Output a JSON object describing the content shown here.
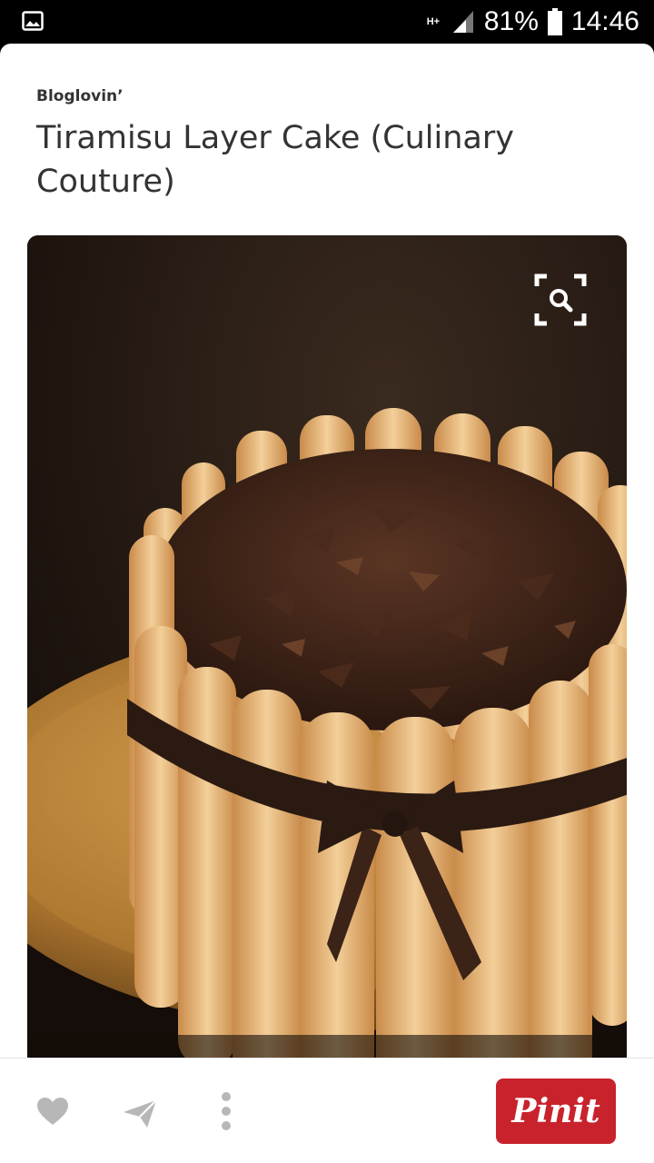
{
  "status_bar": {
    "network": "H+",
    "battery": "81%",
    "time": "14:46"
  },
  "pin": {
    "source": "Bloglovin’",
    "title": "Tiramisu Layer Cake (Culinary Couture)"
  },
  "actions": {
    "icons": [
      "heart-icon",
      "send-icon",
      "more-icon"
    ],
    "pin_button": "Pinit"
  },
  "colors": {
    "pin_red": "#c8232c",
    "icon_gray": "#b7b7b7",
    "text": "#333333"
  }
}
